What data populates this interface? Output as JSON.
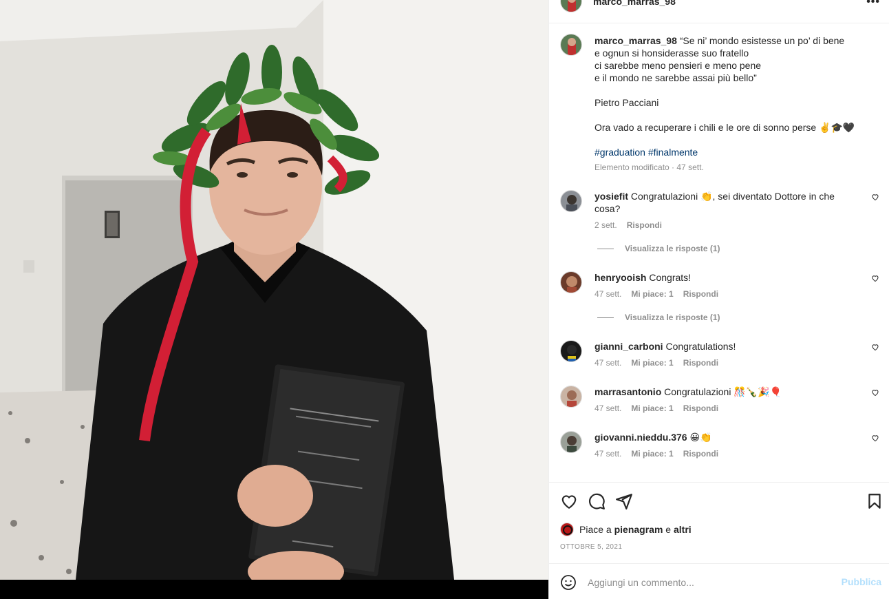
{
  "post": {
    "author": "marco_marras_98",
    "more_icon": "more-horizontal-icon",
    "caption": {
      "username": "marco_marras_98",
      "line1": "“Se ni’ mondo esistesse un po’ di bene",
      "line2": "e ognun si honsiderasse suo fratello",
      "line3": "ci sarebbe meno pensieri e meno pene",
      "line4": "e il mondo ne sarebbe assai più bello”",
      "author_line": "Pietro Pacciani",
      "extra_line": "Ora vado a recuperare i chili e le ore di sonno perse ✌️🎓🖤",
      "hashtag1": "#graduation",
      "hashtag2": "#finalmente",
      "meta": "Elemento modificato · 47 sett."
    }
  },
  "comments": [
    {
      "username": "yosiefit",
      "text": "Congratulazioni 👏, sei diventato Dottore in che cosa?",
      "time": "2 sett.",
      "likes": "",
      "reply": "Rispondi",
      "view_replies": "Visualizza le risposte (1)"
    },
    {
      "username": "henryooish",
      "text": "Congrats!",
      "time": "47 sett.",
      "likes": "Mi piace: 1",
      "reply": "Rispondi",
      "view_replies": "Visualizza le risposte (1)"
    },
    {
      "username": "gianni_carboni",
      "text": "Congratulations!",
      "time": "47 sett.",
      "likes": "Mi piace: 1",
      "reply": "Rispondi"
    },
    {
      "username": "marrasantonio",
      "text": "Congratulazioni 🎊🍾🎉🎈",
      "time": "47 sett.",
      "likes": "Mi piace: 1",
      "reply": "Rispondi"
    },
    {
      "username": "giovanni.nieddu.376",
      "text": "😀👏",
      "time": "47 sett.",
      "likes": "Mi piace: 1",
      "reply": "Rispondi"
    }
  ],
  "actions": {
    "like_icon": "heart-icon",
    "comment_icon": "comment-bubble-icon",
    "share_icon": "paper-plane-icon",
    "save_icon": "bookmark-icon"
  },
  "likes": {
    "prefix": "Piace a",
    "user": "pienagram",
    "joiner": "e",
    "others": "altri"
  },
  "date": "OTTOBRE 5, 2021",
  "add_comment": {
    "placeholder": "Aggiungi un commento...",
    "publish": "Pubblica",
    "emoji_icon": "smiley-icon"
  },
  "colors": {
    "link": "#00376b",
    "meta": "#8e8e8e",
    "publish_disabled": "#b2dffc"
  }
}
